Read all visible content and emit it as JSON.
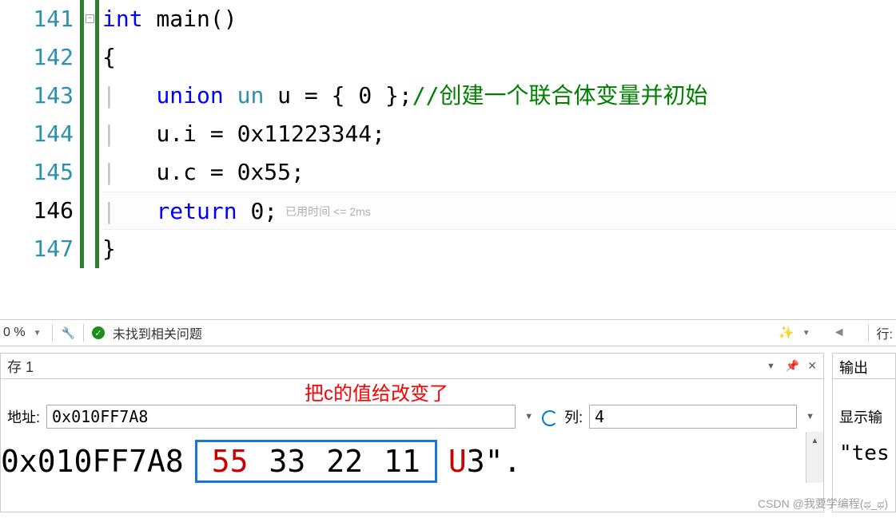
{
  "editor": {
    "lines": [
      {
        "num": "141",
        "kw1": "int",
        "fn": " main()"
      },
      {
        "num": "142",
        "brace": "{"
      },
      {
        "num": "143",
        "kw1": "union",
        "type": " un",
        "txt": " u = { 0 };",
        "cmt": "//创建一个联合体变量并初始"
      },
      {
        "num": "144",
        "txt": "u.i = 0x11223344;"
      },
      {
        "num": "145",
        "txt": "u.c = 0x55;"
      },
      {
        "num": "146",
        "kw1": "return",
        "txt": " 0;",
        "lens": "已用时间 <= 2ms"
      },
      {
        "num": "147",
        "brace": "}"
      }
    ]
  },
  "toolbar": {
    "zoom": "0 %",
    "issues": "未找到相关问题",
    "line_label": "行:"
  },
  "memory": {
    "title": "存 1",
    "annotation": "把c的值给改变了",
    "addr_label": "地址:",
    "addr_value": "0x010FF7A8",
    "col_label": "列:",
    "col_value": "4",
    "display_addr": "0x010FF7A8",
    "bytes": [
      "55",
      "33",
      "22",
      "11"
    ],
    "ascii_red": "U",
    "ascii_rest": "3\"."
  },
  "output": {
    "title": "输出",
    "show_label": "显示输",
    "content": "\"tes"
  },
  "watermark": "CSDN @我要学编程(ಥ_ಥ)"
}
